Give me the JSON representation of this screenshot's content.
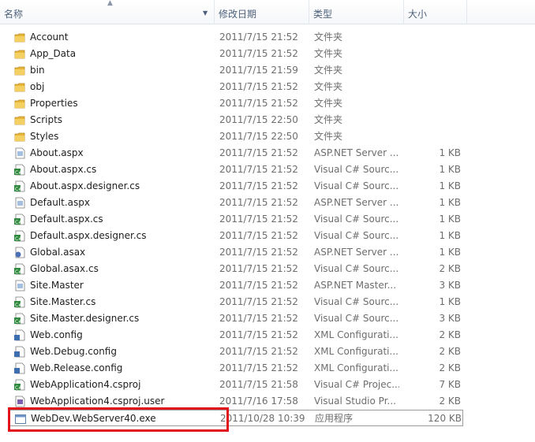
{
  "columns": {
    "name": "名称",
    "date": "修改日期",
    "type": "类型",
    "size": "大小"
  },
  "files": [
    {
      "name": "Account",
      "date": "2011/7/15 21:52",
      "type": "文件夹",
      "size": "",
      "icon": "folder-icon"
    },
    {
      "name": "App_Data",
      "date": "2011/7/15 21:52",
      "type": "文件夹",
      "size": "",
      "icon": "folder-icon"
    },
    {
      "name": "bin",
      "date": "2011/7/15 21:59",
      "type": "文件夹",
      "size": "",
      "icon": "folder-icon"
    },
    {
      "name": "obj",
      "date": "2011/7/15 21:52",
      "type": "文件夹",
      "size": "",
      "icon": "folder-icon"
    },
    {
      "name": "Properties",
      "date": "2011/7/15 21:52",
      "type": "文件夹",
      "size": "",
      "icon": "folder-icon"
    },
    {
      "name": "Scripts",
      "date": "2011/7/15 22:50",
      "type": "文件夹",
      "size": "",
      "icon": "folder-icon"
    },
    {
      "name": "Styles",
      "date": "2011/7/15 22:50",
      "type": "文件夹",
      "size": "",
      "icon": "folder-icon"
    },
    {
      "name": "About.aspx",
      "date": "2011/7/15 21:52",
      "type": "ASP.NET Server ...",
      "size": "1 KB",
      "icon": "aspx-page-icon"
    },
    {
      "name": "About.aspx.cs",
      "date": "2011/7/15 21:52",
      "type": "Visual C# Sourc...",
      "size": "1 KB",
      "icon": "csharp-file-icon"
    },
    {
      "name": "About.aspx.designer.cs",
      "date": "2011/7/15 21:52",
      "type": "Visual C# Sourc...",
      "size": "1 KB",
      "icon": "csharp-file-icon"
    },
    {
      "name": "Default.aspx",
      "date": "2011/7/15 21:52",
      "type": "ASP.NET Server ...",
      "size": "1 KB",
      "icon": "aspx-page-icon"
    },
    {
      "name": "Default.aspx.cs",
      "date": "2011/7/15 21:52",
      "type": "Visual C# Sourc...",
      "size": "1 KB",
      "icon": "csharp-file-icon"
    },
    {
      "name": "Default.aspx.designer.cs",
      "date": "2011/7/15 21:52",
      "type": "Visual C# Sourc...",
      "size": "1 KB",
      "icon": "csharp-file-icon"
    },
    {
      "name": "Global.asax",
      "date": "2011/7/15 21:52",
      "type": "ASP.NET Server ...",
      "size": "1 KB",
      "icon": "asax-file-icon"
    },
    {
      "name": "Global.asax.cs",
      "date": "2011/7/15 21:52",
      "type": "Visual C# Sourc...",
      "size": "2 KB",
      "icon": "csharp-file-icon"
    },
    {
      "name": "Site.Master",
      "date": "2011/7/15 21:52",
      "type": "ASP.NET Master...",
      "size": "3 KB",
      "icon": "master-page-icon"
    },
    {
      "name": "Site.Master.cs",
      "date": "2011/7/15 21:52",
      "type": "Visual C# Sourc...",
      "size": "1 KB",
      "icon": "csharp-file-icon"
    },
    {
      "name": "Site.Master.designer.cs",
      "date": "2011/7/15 21:52",
      "type": "Visual C# Sourc...",
      "size": "3 KB",
      "icon": "csharp-file-icon"
    },
    {
      "name": "Web.config",
      "date": "2011/7/15 21:52",
      "type": "XML Configurati...",
      "size": "2 KB",
      "icon": "config-file-icon"
    },
    {
      "name": "Web.Debug.config",
      "date": "2011/7/15 21:52",
      "type": "XML Configurati...",
      "size": "2 KB",
      "icon": "config-file-icon"
    },
    {
      "name": "Web.Release.config",
      "date": "2011/7/15 21:52",
      "type": "XML Configurati...",
      "size": "2 KB",
      "icon": "config-file-icon"
    },
    {
      "name": "WebApplication4.csproj",
      "date": "2011/7/15 21:58",
      "type": "Visual C# Projec...",
      "size": "7 KB",
      "icon": "csproj-file-icon"
    },
    {
      "name": "WebApplication4.csproj.user",
      "date": "2011/7/16 17:58",
      "type": "Visual Studio Pr...",
      "size": "2 KB",
      "icon": "user-file-icon"
    },
    {
      "name": "WebDev.WebServer40.exe",
      "date": "2011/10/28 10:39",
      "type": "应用程序",
      "size": "120 KB",
      "icon": "exe-file-icon",
      "selected": true
    }
  ],
  "colors": {
    "folder": "#e8b73a",
    "highlight": "#e3131c",
    "header_text": "#4c607a"
  }
}
